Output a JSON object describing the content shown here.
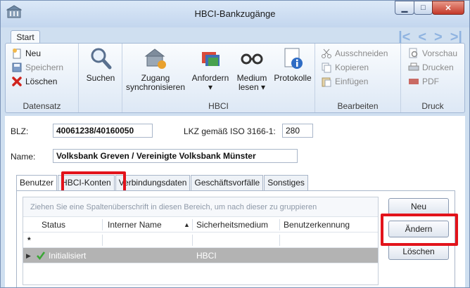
{
  "window": {
    "title": "HBCI-Bankzugänge",
    "controls": {
      "minimize": "▁",
      "maximize": "□",
      "close": "✕"
    }
  },
  "ribbon_tab": "Start",
  "nav_arrows": [
    "|<",
    "<",
    ">",
    ">|"
  ],
  "groups": {
    "datensatz": {
      "label": "Datensatz",
      "neu": "Neu",
      "speichern": "Speichern",
      "loeschen": "Löschen"
    },
    "suchen": "Suchen",
    "hbci": {
      "label": "HBCI",
      "zugang_line1": "Zugang",
      "zugang_line2": "synchronisieren",
      "anfordern_line1": "Anfordern",
      "medium_line1": "Medium",
      "medium_line2": "lesen",
      "protokolle": "Protokolle"
    },
    "bearbeiten": {
      "label": "Bearbeiten",
      "ausschneiden": "Ausschneiden",
      "kopieren": "Kopieren",
      "einfuegen": "Einfügen"
    },
    "druck": {
      "label": "Druck",
      "vorschau": "Vorschau",
      "drucken": "Drucken",
      "pdf": "PDF"
    }
  },
  "form": {
    "blz_label": "BLZ:",
    "blz_value": "40061238/40160050",
    "lkz_label": "LKZ gemäß ISO 3166-1:",
    "lkz_value": "280",
    "name_label": "Name:",
    "name_value": "Volksbank Greven / Vereinigte Volksbank Münster"
  },
  "tabs": [
    "Benutzer",
    "HBCI-Konten",
    "Verbindungsdaten",
    "Geschäftsvorfälle",
    "Sonstiges"
  ],
  "grid": {
    "group_hint": "Ziehen Sie eine Spaltenüberschrift in diesen Bereich, um nach dieser zu gruppieren",
    "columns": [
      "Status",
      "Interner Name",
      "Sicherheitsmedium",
      "Benutzerkennung"
    ],
    "sort_indicator": "▲",
    "new_row_marker": "*",
    "rows": [
      {
        "marker": "▶",
        "status": "Initialisiert",
        "internal_name": "",
        "security_medium": "HBCI",
        "user_id": ""
      }
    ]
  },
  "buttons": {
    "neu": "Neu",
    "aendern": "Ändern",
    "loeschen": "Löschen"
  },
  "colors": {
    "highlight": "#e2131b",
    "selected_row": "#b3b3b3",
    "status_check": "#3aa635"
  }
}
